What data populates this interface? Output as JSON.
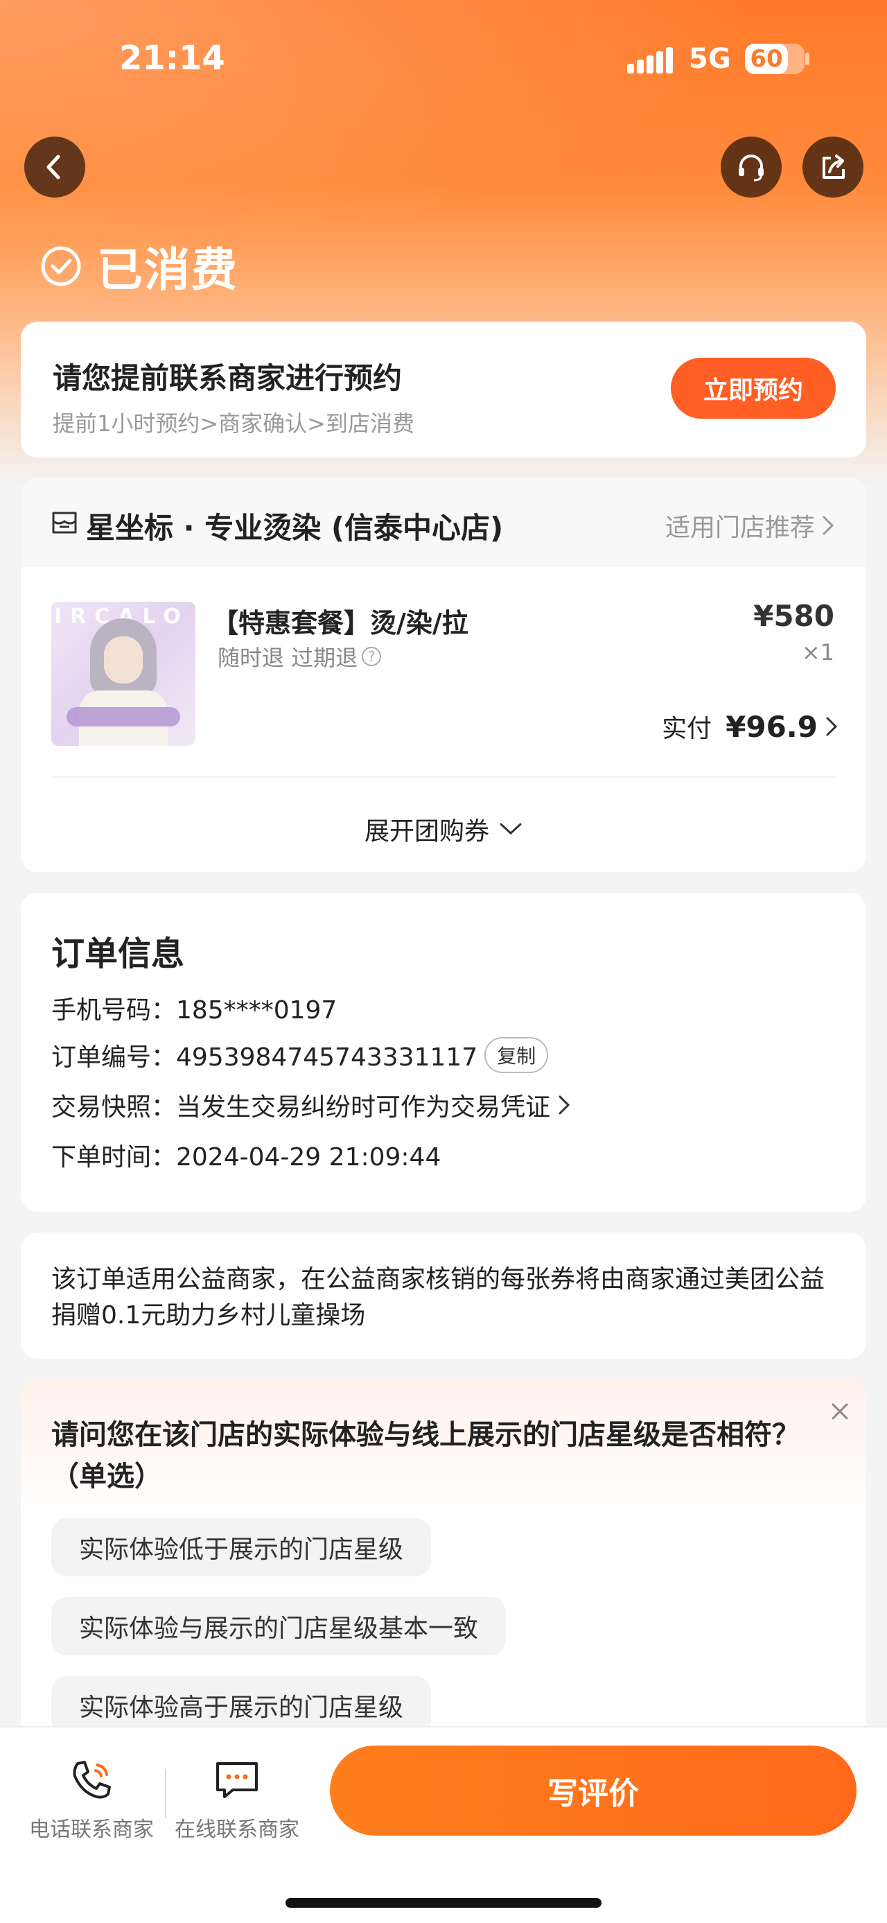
{
  "status_bar": {
    "time": "21:14",
    "network": "5G",
    "battery": "60"
  },
  "header": {
    "back_icon": "chevron-left-icon",
    "service_icon": "headset-icon",
    "share_icon": "share-icon"
  },
  "order_status": {
    "icon": "check-circle-icon",
    "text": "已消费"
  },
  "appointment": {
    "title": "请您提前联系商家进行预约",
    "subtitle": "提前1小时预约>商家确认>到店消费",
    "button": "立即预约"
  },
  "shop": {
    "icon": "store-icon",
    "name": "星坐标 · 专业烫染 (信泰中心店)",
    "recommend_link": "适用门店推荐"
  },
  "product": {
    "image_alt": "IRCALO",
    "title": "【特惠套餐】烫/染/拉",
    "tags": "随时退 过期退",
    "help_icon": "question-circle-icon",
    "help_glyph": "?",
    "price": "¥580",
    "quantity": "×1",
    "paid_label": "实付",
    "paid_amount": "¥96.9",
    "expand_label": "展开团购券"
  },
  "order_info": {
    "title": "订单信息",
    "phone": "手机号码：185****0197",
    "order_no": "订单编号：4953984745743331117",
    "copy_button": "复制",
    "snapshot": "交易快照：当发生交易纠纷时可作为交易凭证",
    "order_time": "下单时间：2024-04-29 21:09:44"
  },
  "charity": {
    "text": "该订单适用公益商家，在公益商家核销的每张券将由商家通过美团公益捐赠0.1元助力乡村儿童操场"
  },
  "survey": {
    "question": "请问您在该门店的实际体验与线上展示的门店星级是否相符？（单选）",
    "options": [
      "实际体验低于展示的门店星级",
      "实际体验与展示的门店星级基本一致",
      "实际体验高于展示的门店星级"
    ]
  },
  "bottom_bar": {
    "phone_label": "电话联系商家",
    "chat_label": "在线联系商家",
    "review_button": "写评价"
  },
  "colors": {
    "accent": "#ff5e24",
    "hero": "#ff7a2a"
  }
}
